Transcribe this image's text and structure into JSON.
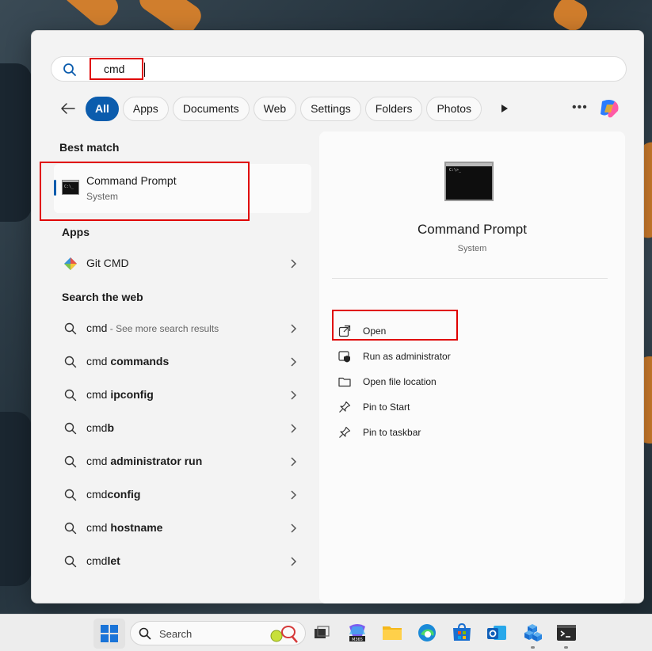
{
  "search": {
    "value": "cmd"
  },
  "filters": [
    "All",
    "Apps",
    "Documents",
    "Web",
    "Settings",
    "Folders",
    "Photos"
  ],
  "sections": {
    "best_match": "Best match",
    "apps": "Apps",
    "search_web": "Search the web"
  },
  "best_match": {
    "name": "Command Prompt",
    "subtitle": "System"
  },
  "apps": [
    {
      "name": "Git CMD"
    }
  ],
  "web_results": [
    {
      "prefix": "cmd",
      "bold": "",
      "hint": " - See more search results"
    },
    {
      "prefix": "cmd ",
      "bold": "commands",
      "hint": ""
    },
    {
      "prefix": "cmd ",
      "bold": "ipconfig",
      "hint": ""
    },
    {
      "prefix": "cmd",
      "bold": "b",
      "hint": ""
    },
    {
      "prefix": "cmd ",
      "bold": "administrator run",
      "hint": ""
    },
    {
      "prefix": "cmd",
      "bold": "config",
      "hint": ""
    },
    {
      "prefix": "cmd ",
      "bold": "hostname",
      "hint": ""
    },
    {
      "prefix": "cmd",
      "bold": "let",
      "hint": ""
    }
  ],
  "detail": {
    "name": "Command Prompt",
    "subtitle": "System",
    "actions": [
      "Open",
      "Run as administrator",
      "Open file location",
      "Pin to Start",
      "Pin to taskbar"
    ]
  },
  "taskbar": {
    "search_placeholder": "Search",
    "m365_label": "M365"
  },
  "colors": {
    "accent": "#0b5cad",
    "highlight": "#e00000"
  }
}
